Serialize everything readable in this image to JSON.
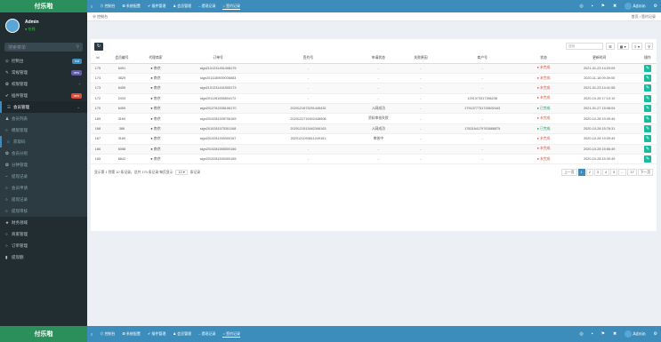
{
  "brand": "付乐啦",
  "user": {
    "name": "Admin",
    "status": "● 在线"
  },
  "sidebar": {
    "search_placeholder": "搜索菜单",
    "items": [
      {
        "icon": "⊙",
        "label": "控制台",
        "badge": "hot",
        "badge_color": "#3c8dbc"
      },
      {
        "icon": "✎",
        "label": "常规管理",
        "badge": "new",
        "badge_color": "#605ca8"
      },
      {
        "icon": "❂",
        "label": "权限管理",
        "arrow": "‹"
      },
      {
        "icon": "✔",
        "label": "插件管理",
        "badge": "new",
        "badge_color": "#dd4b39"
      },
      {
        "icon": "☰",
        "label": "会员管理",
        "arrow": "⌄"
      }
    ],
    "sub_items": [
      {
        "icon": "♟",
        "label": "会员列表"
      },
      {
        "icon": "○",
        "label": "模版管理"
      },
      {
        "icon": "○",
        "label": "获取码"
      },
      {
        "icon": "❂",
        "label": "会员分组"
      },
      {
        "icon": "❂",
        "label": "分钟管理"
      },
      {
        "icon": "–",
        "label": "提现记录"
      },
      {
        "icon": "○",
        "label": "会员申请"
      },
      {
        "icon": "○",
        "label": "提现记录"
      },
      {
        "icon": "○",
        "label": "提现审核"
      }
    ],
    "items2": [
      {
        "icon": "★",
        "label": "财务领域"
      },
      {
        "icon": "○",
        "label": "商家管理"
      },
      {
        "icon": "○",
        "label": "订单管理"
      },
      {
        "icon": "▮",
        "label": "提现额"
      }
    ]
  },
  "topnav": {
    "items": [
      {
        "icon": "≡",
        "label": ""
      },
      {
        "icon": "⊙",
        "label": "控制台"
      },
      {
        "icon": "❂",
        "label": "系统配置"
      },
      {
        "icon": "✔",
        "label": "插件管理"
      },
      {
        "icon": "♟",
        "label": "会员管理"
      },
      {
        "icon": "–",
        "label": "提现记录"
      },
      {
        "icon": "○",
        "label": "签约记录"
      }
    ],
    "right_icons": [
      "◎",
      "▪",
      "⚑",
      "✖"
    ],
    "user": "Admin",
    "settings": "⚙"
  },
  "breadcrumb": {
    "left": "⊕ 控制台",
    "right": "首页 / 签约记录"
  },
  "toolbar": {
    "refresh": "↻",
    "search_placeholder": "搜索",
    "tools": [
      "☰",
      "▦ ▾",
      "⇩ ▾",
      "⚲"
    ]
  },
  "table": {
    "columns": [
      "Id",
      "会员编号",
      "代理商家",
      "订单号",
      "签约号",
      "申请状态",
      "失败原因",
      "商户号",
      "状态",
      "更新时间",
      "操作"
    ],
    "rows": [
      {
        "id": "175",
        "member": "6491",
        "agent": "● 南京",
        "order": "slgn2101231451408175",
        "sign": "-",
        "apply": "-",
        "reason": "-",
        "merchant": "-",
        "status": "● 未完成",
        "status_class": "st-red",
        "time": "2021-01-23 14:20:09"
      },
      {
        "id": "174",
        "member": "0829",
        "agent": "● 南京",
        "order": "slgn2011180939006683",
        "sign": "-",
        "apply": "-",
        "reason": "-",
        "merchant": "-",
        "status": "● 未完成",
        "status_class": "st-red",
        "time": "2020-11-18 09:39:00"
      },
      {
        "id": "173",
        "member": "6459",
        "agent": "● 南京",
        "order": "slgn2101231441505173",
        "sign": "-",
        "apply": "-",
        "reason": "-",
        "merchant": "-",
        "status": "● 未完成",
        "status_class": "st-red",
        "time": "2021-01-23 14:41:55"
      },
      {
        "id": "172",
        "member": "2433",
        "agent": "● 南京",
        "order": "slgn2011281636804172",
        "sign": "-",
        "apply": "-",
        "reason": "-",
        "merchant": "1291373317286238",
        "status": "● 未完成",
        "status_class": "st-red",
        "time": "2020-10-28 17:10:10"
      },
      {
        "id": "170",
        "member": "6459",
        "agent": "● 南京",
        "order": "slgn2012761536106170",
        "sign": "2020121673291445432",
        "apply": "入网成功",
        "reason": "-",
        "merchant": "1791377731728632443",
        "status": "● 已完成",
        "status_class": "st-green",
        "time": "2021-01-27 15:08:04"
      },
      {
        "id": "169",
        "member": "3169",
        "agent": "● 南京",
        "order": "slgn2010281935706169",
        "sign": "2020121719302448508",
        "apply": "资料审核失败",
        "reason": "-",
        "merchant": "-",
        "status": "● 未完成",
        "status_class": "st-red",
        "time": "2020-10-28 19:39:49"
      },
      {
        "id": "168",
        "member": "386",
        "agent": "● 南京",
        "order": "slgn2010281575301168",
        "sign": "2020121513462346163",
        "apply": "入网成功",
        "reason": "-",
        "merchant": "1783164179763888875",
        "status": "● 已完成",
        "status_class": "st-green",
        "time": "2020-10-28 15:76:31"
      },
      {
        "id": "167",
        "member": "3169",
        "agent": "● 南京",
        "order": "slgn2010281935300167",
        "sign": "2020121093511249151",
        "apply": "审核中",
        "reason": "-",
        "merchant": "-",
        "status": "● 未完成",
        "status_class": "st-red",
        "time": "2020-10-28 19:39:49"
      },
      {
        "id": "166",
        "member": "6088",
        "agent": "● 南京",
        "order": "slgn2010281565000166",
        "sign": "-",
        "apply": "-",
        "reason": "-",
        "merchant": "-",
        "status": "● 未完成",
        "status_class": "st-red",
        "time": "2020-10-28 15:56:49"
      },
      {
        "id": "165",
        "member": "6842",
        "agent": "● 南京",
        "order": "slgn2010281530400165",
        "sign": "-",
        "apply": "-",
        "reason": "-",
        "merchant": "-",
        "status": "● 未完成",
        "status_class": "st-red",
        "time": "2020-10-28 15:30:49"
      }
    ],
    "edit_icon": "✎"
  },
  "pagination": {
    "summary": "显示第 1 到第 10 条记录，总共 170 条记录 每页显示",
    "per_page": "10 ▾",
    "suffix": "条记录",
    "pages": [
      "上一页",
      "1",
      "2",
      "3",
      "4",
      "5",
      "...",
      "17",
      "下一页"
    ],
    "current": "1"
  }
}
